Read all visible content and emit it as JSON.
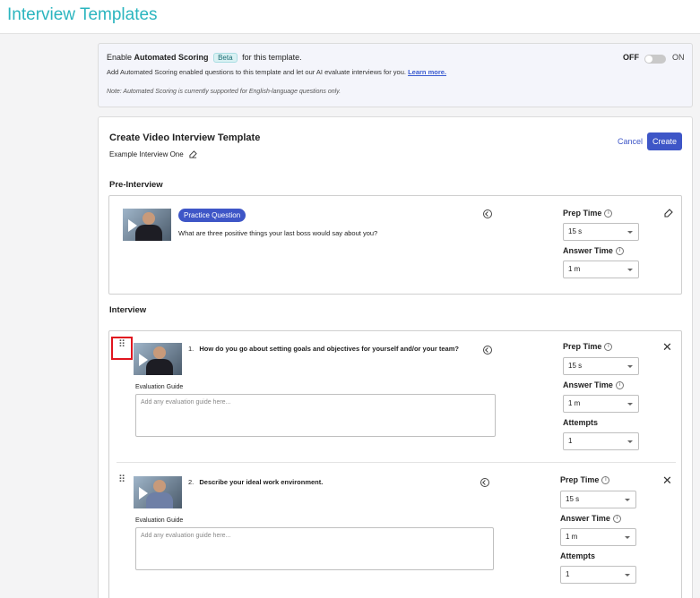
{
  "header": {
    "title": "Interview Templates"
  },
  "scoring": {
    "enable_prefix": "Enable",
    "enable_bold": "Automated Scoring",
    "beta": "Beta",
    "enable_suffix": "for this template.",
    "description": "Add Automated Scoring enabled questions to this template and let our AI evaluate interviews for you.",
    "learn_more": "Learn more.",
    "note": "Note: Automated Scoring is currently supported for English-language questions only.",
    "toggle_off": "OFF",
    "toggle_on": "ON",
    "state": "off"
  },
  "template": {
    "title": "Create Video Interview Template",
    "name": "Example Interview One",
    "cancel": "Cancel",
    "create": "Create"
  },
  "pre_interview": {
    "heading": "Pre-Interview",
    "badge": "Practice Question",
    "question": "What are three positive things your last boss would say about you?",
    "prep_label": "Prep Time",
    "prep_value": "15 s",
    "answer_label": "Answer Time",
    "answer_value": "1 m"
  },
  "interview": {
    "heading": "Interview",
    "questions": [
      {
        "number": "1.",
        "text": "How do you go about setting goals and objectives for yourself and/or your team?",
        "guide_label": "Evaluation Guide",
        "guide_placeholder": "Add any evaluation guide here...",
        "prep_label": "Prep Time",
        "prep_value": "15 s",
        "answer_label": "Answer Time",
        "answer_value": "1 m",
        "attempts_label": "Attempts",
        "attempts_value": "1"
      },
      {
        "number": "2.",
        "text": "Describe your ideal work environment.",
        "guide_label": "Evaluation Guide",
        "guide_placeholder": "Add any evaluation guide here...",
        "prep_label": "Prep Time",
        "prep_value": "15 s",
        "answer_label": "Answer Time",
        "answer_value": "1 m",
        "attempts_label": "Attempts",
        "attempts_value": "1"
      }
    ]
  },
  "colors": {
    "brand_teal": "#2bb5bf",
    "primary": "#3e56c7",
    "highlight": "#e0151f"
  }
}
